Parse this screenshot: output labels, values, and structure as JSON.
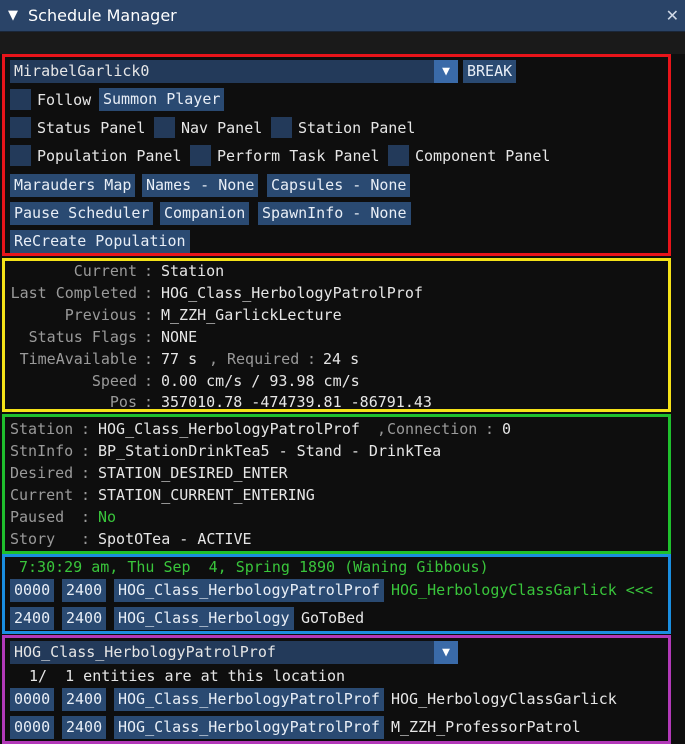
{
  "window": {
    "title": "Schedule Manager",
    "collapse_glyph": "▼",
    "close_glyph": "✕"
  },
  "controls": {
    "character_select": "MirabelGarlick0",
    "break_label": "BREAK",
    "follow_label": "Follow",
    "summon_label": "Summon Player",
    "status_panel_label": "Status Panel",
    "nav_panel_label": "Nav Panel",
    "station_panel_label": "Station Panel",
    "population_panel_label": "Population Panel",
    "perform_task_label": "Perform Task Panel",
    "component_panel_label": "Component Panel",
    "marauders_map_label": "Marauders Map",
    "names_label": "Names - None",
    "capsules_label": "Capsules - None",
    "pause_scheduler_label": "Pause Scheduler",
    "companion_label": "Companion",
    "spawninfo_label": "SpawnInfo - None",
    "recreate_label": "ReCreate Population"
  },
  "status": {
    "rows": [
      {
        "label": "Current",
        "value": "Station"
      },
      {
        "label": "Last Completed",
        "value": "HOG_Class_HerbologyPatrolProf"
      },
      {
        "label": "Previous",
        "value": "M_ZZH_GarlickLecture"
      },
      {
        "label": "Status Flags",
        "value": "NONE"
      },
      {
        "label": "TimeAvailable",
        "value": "77 s"
      },
      {
        "label": "Speed",
        "value": "0.00 cm/s / 93.98 cm/s"
      },
      {
        "label": "Pos",
        "value": "357010.78 -474739.81 -86791.43"
      }
    ],
    "required_label": "Required",
    "required_value": "24 s"
  },
  "station": {
    "rows": [
      {
        "label": "Station",
        "value": "HOG_Class_HerbologyPatrolProf"
      },
      {
        "label": "StnInfo",
        "value": "BP_StationDrinkTea5 - Stand - DrinkTea"
      },
      {
        "label": "Desired",
        "value": "STATION_DESIRED_ENTER"
      },
      {
        "label": "Current",
        "value": "STATION_CURRENT_ENTERING"
      },
      {
        "label": "Paused",
        "value": "No"
      },
      {
        "label": "Story",
        "value": "SpotOTea - ACTIVE"
      }
    ],
    "connection_label": "Connection",
    "connection_value": "0"
  },
  "schedule": {
    "datetime": "7:30:29 am, Thu Sep  4, Spring 1890 (Waning Gibbous)",
    "entries": [
      {
        "start": "0000",
        "end": "2400",
        "station": "HOG_Class_HerbologyPatrolProf",
        "task": "HOG_HerbologyClassGarlick <<<"
      },
      {
        "start": "2400",
        "end": "2400",
        "station": "HOG_Class_Herbology",
        "task": "GoToBed"
      }
    ]
  },
  "location": {
    "select": "HOG_Class_HerbologyPatrolProf",
    "count_text": "1/  1 entities are at this location",
    "entries": [
      {
        "start": "0000",
        "end": "2400",
        "station": "HOG_Class_HerbologyPatrolProf",
        "task": "HOG_HerbologyClassGarlick"
      },
      {
        "start": "0000",
        "end": "2400",
        "station": "HOG_Class_HerbologyPatrolProf",
        "task": "M_ZZH_ProfessorPatrol"
      }
    ]
  },
  "colors": {
    "panel_bg": "#0e0e0e",
    "button": "#2a4a72",
    "titlebar": "#2a4468",
    "border_red": "#e8141a",
    "border_yellow": "#f5e218",
    "border_green": "#1fbf2d",
    "border_blue": "#1a8ee0",
    "border_purple": "#b239b8",
    "active_green": "#39c53b"
  }
}
